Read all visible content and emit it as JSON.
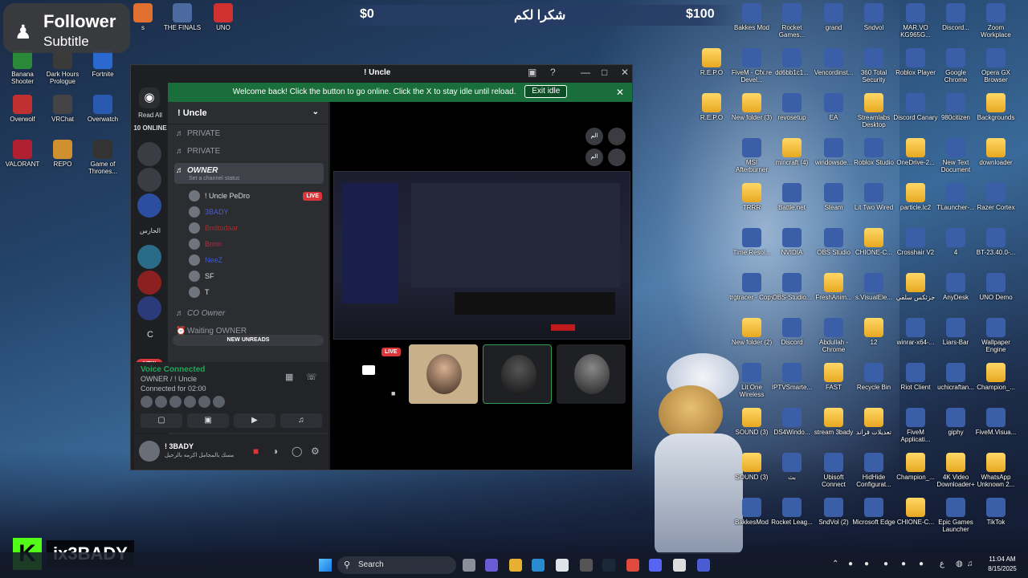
{
  "overlay": {
    "follower_title": "Follower",
    "follower_sub": "Subtitle",
    "stat_left": "$0",
    "stat_mid": "شكرا لكم",
    "stat_right": "$100",
    "brand_k": "K",
    "brand_name": "ix3BADY"
  },
  "desktop_left": [
    {
      "label": "s"
    },
    {
      "label": "THE FINALS"
    },
    {
      "label": "UNO"
    },
    {
      "label": "Banana Shooter"
    },
    {
      "label": "Dark Hours Prologue"
    },
    {
      "label": "Fortnite"
    },
    {
      "label": "Overwolf"
    },
    {
      "label": "VRChat"
    },
    {
      "label": "Overwatch"
    },
    {
      "label": "VALORANT"
    },
    {
      "label": "REPO"
    },
    {
      "label": "Game of Thrones..."
    }
  ],
  "desktop_right": [
    [
      "Bakkes Mod",
      "Rocket Games...",
      "grand",
      "Sndvol",
      "MAR.VO KG965G...",
      "Discord...",
      "Zoom Workplace"
    ],
    [
      "R.E.P.O",
      "FiveM - Cfx.re Devel...",
      "dd6bb1c1...",
      "Vencordinst...",
      "360 Total Security",
      "Roblox Player",
      "Google Chrome",
      "Opera GX Browser"
    ],
    [
      "R.E.P.O",
      "New folder (3)",
      "revosetup",
      "EA",
      "Streamlabs Desktop",
      "Discord Canary",
      "980citizen",
      "Backgrounds"
    ],
    [
      "MSI Afterburner",
      "mincraft (4)",
      "windowsde...",
      "Roblox Studio",
      "OneDrive-2...",
      "New Text Document",
      "downloader"
    ],
    [
      "TRRR",
      "Battle.net",
      "Steam",
      "Lit Two Wired",
      "particle.lc2",
      "TLauncher-...",
      "Razer Cortex"
    ],
    [
      "Time.Resol...",
      "NVIDIA",
      "OBS Studio",
      "CHIONE-C...",
      "Crosshair V2",
      "4",
      "BT-23.40.0-..."
    ],
    [
      "trgtracer - Copy",
      "OBS-Studio...",
      "FreshAnim...",
      "s.VisualEle...",
      "جزئكس سلفي",
      "AnyDesk",
      "UNO Demo"
    ],
    [
      "New folder (2)",
      "Discord",
      "Abdullah - Chrome",
      "12",
      "winrar-x64-...",
      "Liars-Bar",
      "Wallpaper Engine"
    ],
    [
      "Lit One Wireless",
      "IPTVSmarte...",
      "FAST",
      "Recycle Bin",
      "Riot Client",
      "uchicraftan...",
      "Champion_..."
    ],
    [
      "SOUND (3)",
      "DS4Windo...",
      "stream 3bady",
      "تعديلات قراند",
      "FiveM Applicati...",
      "giphy",
      "FiveM.Visua..."
    ],
    [
      "SOUND (3)",
      "بث",
      "Ubisoft Connect",
      "HidHide Configurat...",
      "Champion_...",
      "4K Video Downloader+",
      "WhatsApp Unknown 2..."
    ],
    [
      "BakkesMod",
      "Rocket Leag...",
      "SndVol (2)",
      "Microsoft Edge",
      "CHIONE-C...",
      "Epic Games Launcher",
      "TikTok"
    ]
  ],
  "discord": {
    "title": "! Uncle",
    "banner_text": "Welcome back! Click the button to go online. Click the X to stay idle until reload.",
    "exit_idle": "Exit idle",
    "read_all": "Read All",
    "online": "10 ONLINE",
    "server_label_1": "الحارس",
    "server_label_2": "C",
    "new_pill": "NEW",
    "guild": "! Uncle",
    "channels": [
      {
        "name": "PRIVATE"
      },
      {
        "name": "PRIVATE"
      },
      {
        "name": "OWNER"
      },
      {
        "name": "Set a channel status"
      }
    ],
    "users": [
      {
        "name": "! Uncle PeDro",
        "badge": "LIVE"
      },
      {
        "name": "3BADY"
      },
      {
        "name": "Bndtodaar"
      },
      {
        "name": "Bnnn"
      },
      {
        "name": "NeeZ"
      },
      {
        "name": "SF"
      },
      {
        "name": "T"
      }
    ],
    "co_owner": "CO Owner",
    "waiting": "Waiting OWNER",
    "new_unreads": "NEW UNREADS",
    "voice_connected": "Voice Connected",
    "voice_channel": "OWNER / ! Uncle",
    "connected_for": "Connected for 02:00",
    "user_name": "! 3BADY",
    "user_status": "مسك بالمجامل اكرمه بالرحيل",
    "live_label": "LIVE",
    "mini1": "الم",
    "mini2": "الم"
  },
  "taskbar": {
    "search": "Search",
    "time": "11:04 AM",
    "date": "8/15/2025",
    "lang": "ع"
  }
}
